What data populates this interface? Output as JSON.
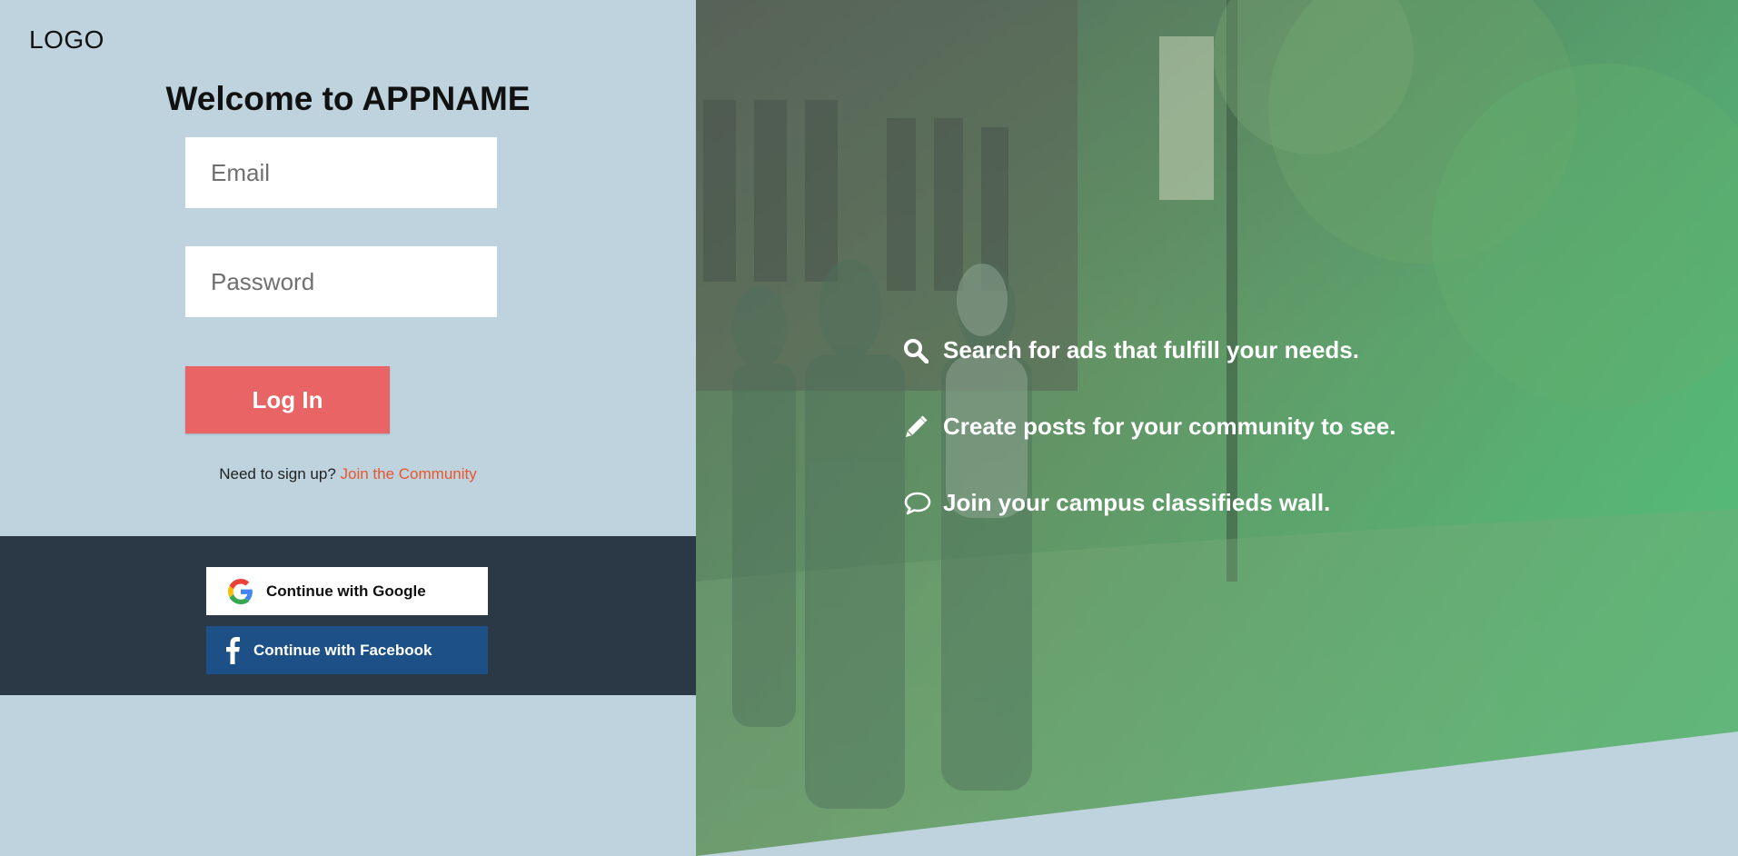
{
  "brand": {
    "logo": "LOGO"
  },
  "login": {
    "title": "Welcome to APPNAME",
    "email_placeholder": "Email",
    "password_placeholder": "Password",
    "submit_label": "Log In",
    "signup_prompt": "Need to sign up?",
    "signup_link": "Join the Community"
  },
  "social": {
    "google_label": "Continue with Google",
    "google_icon": "google-icon",
    "facebook_label": "Continue with Facebook",
    "facebook_icon": "facebook-icon"
  },
  "features": [
    {
      "icon": "search-icon",
      "text": "Search for ads that fulfill your needs."
    },
    {
      "icon": "pencil-icon",
      "text": "Create posts for your community to see."
    },
    {
      "icon": "speech-bubble-icon",
      "text": "Join your campus classifieds wall."
    }
  ],
  "colors": {
    "left_panel_bg": "#bed3de",
    "login_button": "#e96464",
    "signup_link": "#e8572e",
    "social_band": "#2b3845",
    "facebook_button": "#1c5087",
    "hero_green": "#50c37d"
  }
}
